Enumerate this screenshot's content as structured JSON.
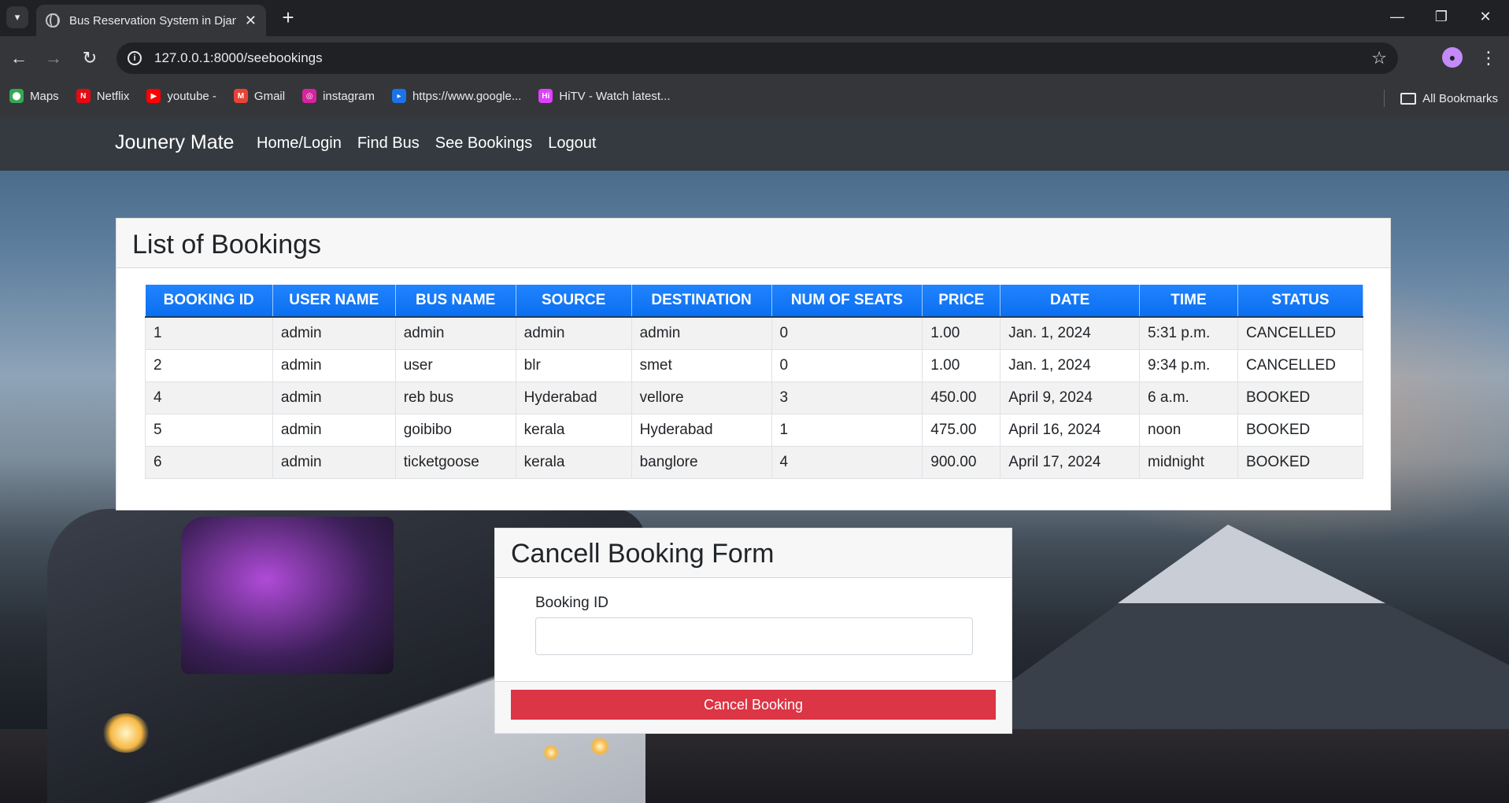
{
  "browser": {
    "tab_title": "Bus Reservation System in Djan",
    "url": "127.0.0.1:8000/seebookings",
    "bookmarks": [
      {
        "label": "Maps",
        "color": "#34a853"
      },
      {
        "label": "Netflix",
        "color": "#e50914"
      },
      {
        "label": "youtube -",
        "color": "#ff0000"
      },
      {
        "label": "Gmail",
        "color": "#ea4335"
      },
      {
        "label": "instagram",
        "color": "#d6249f"
      },
      {
        "label": "https://www.google...",
        "color": "#1a73e8"
      },
      {
        "label": "HiTV - Watch latest...",
        "color": "#e040fb"
      }
    ],
    "all_bookmarks": "All Bookmarks"
  },
  "site": {
    "brand": "Jounery Mate",
    "nav": [
      "Home/Login",
      "Find Bus",
      "See Bookings",
      "Logout"
    ]
  },
  "bookings": {
    "title": "List of Bookings",
    "columns": [
      "BOOKING ID",
      "USER NAME",
      "BUS NAME",
      "SOURCE",
      "DESTINATION",
      "NUM OF SEATS",
      "PRICE",
      "DATE",
      "TIME",
      "STATUS"
    ],
    "rows": [
      [
        "1",
        "admin",
        "admin",
        "admin",
        "admin",
        "0",
        "1.00",
        "Jan. 1, 2024",
        "5:31 p.m.",
        "CANCELLED"
      ],
      [
        "2",
        "admin",
        "user",
        "blr",
        "smet",
        "0",
        "1.00",
        "Jan. 1, 2024",
        "9:34 p.m.",
        "CANCELLED"
      ],
      [
        "4",
        "admin",
        "reb bus",
        "Hyderabad",
        "vellore",
        "3",
        "450.00",
        "April 9, 2024",
        "6 a.m.",
        "BOOKED"
      ],
      [
        "5",
        "admin",
        "goibibo",
        "kerala",
        "Hyderabad",
        "1",
        "475.00",
        "April 16, 2024",
        "noon",
        "BOOKED"
      ],
      [
        "6",
        "admin",
        "ticketgoose",
        "kerala",
        "banglore",
        "4",
        "900.00",
        "April 17, 2024",
        "midnight",
        "BOOKED"
      ]
    ]
  },
  "cancel_form": {
    "title": "Cancell Booking Form",
    "label": "Booking ID",
    "value": "",
    "button": "Cancel Booking"
  },
  "colors": {
    "navbar": "#343a40",
    "table_header": "#0d7bff",
    "danger": "#dc3545"
  }
}
